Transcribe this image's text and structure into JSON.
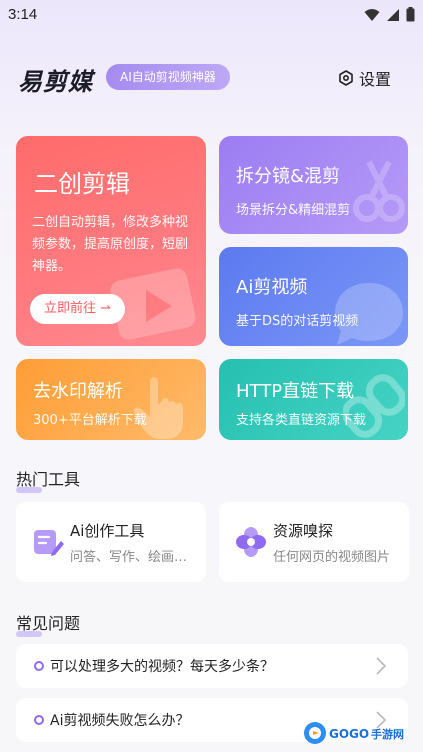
{
  "status_bar": {
    "time": "3:14"
  },
  "header": {
    "logo": "易剪媒",
    "tag": "AI自动剪视频神器",
    "settings_label": "设置"
  },
  "cards": {
    "main": {
      "title": "二创剪辑",
      "desc": "二创自动剪辑，修改多种视频参数，提高原创度，短剧神器。",
      "button": "立即前往 ⇀"
    },
    "split": {
      "title": "拆分镜&混剪",
      "desc": "场景拆分&精细混剪"
    },
    "ai": {
      "title": "Ai剪视频",
      "desc": "基于DS的对话剪视频"
    },
    "watermark": {
      "title": "去水印解析",
      "desc": "300+平台解析下载"
    },
    "http": {
      "title": "HTTP直链下载",
      "desc": "支持各类直链资源下载"
    }
  },
  "hot_tools": {
    "title": "热门工具",
    "items": [
      {
        "name": "Ai创作工具",
        "desc": "问答、写作、绘画…"
      },
      {
        "name": "资源嗅探",
        "desc": "任何网页的视频图片"
      }
    ]
  },
  "faq": {
    "title": "常见问题",
    "items": [
      {
        "question": "可以处理多大的视频？每天多少条？"
      },
      {
        "question": "Ai剪视频失败怎么办？"
      }
    ]
  },
  "watermark_logo": "GOGO手游网",
  "colors": {
    "accent": "#8e6bf0",
    "main_card": "#ff6b6b",
    "split_card": "#9b7df2",
    "ai_card": "#5c7af0",
    "wm_card": "#ff9d35",
    "http_card": "#25c0b0"
  }
}
